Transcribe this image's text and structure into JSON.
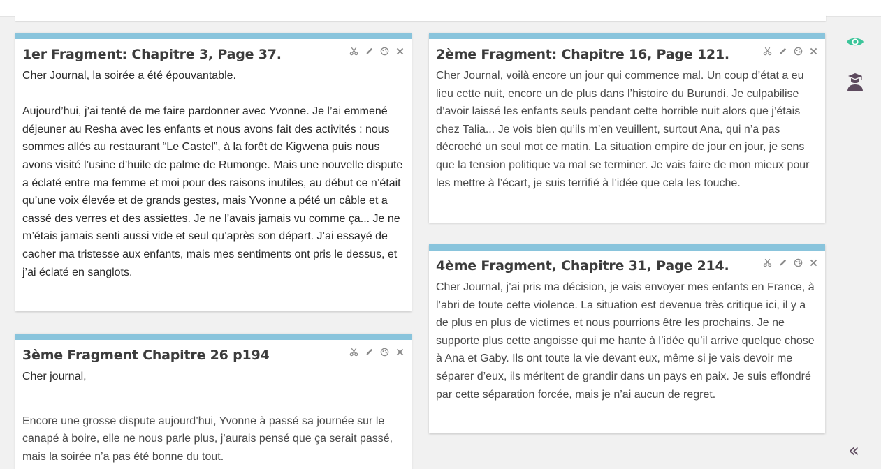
{
  "cards": [
    {
      "title": "1er Fragment: Chapitre 3, Page 37.",
      "paragraphs": [
        "Cher Journal, la soirée a été épouvantable.",
        "Aujourd’hui, j’ai tenté de me faire pardonner avec Yvonne. Je l’ai emmené déjeuner au Resha avec les enfants et nous avons fait des activités : nous sommes allés au restaurant “Le Castel”, à la forêt de Kigwena puis nous avons visité l’usine d’huile de palme de Rumonge. Mais une nouvelle dispute a éclaté entre ma femme et moi pour des raisons inutiles, au début ce n’était qu’une voix élevée et de grands gestes, mais Yvonne a pété un câble et a cassé des verres et des assiettes. Je ne l’avais jamais vu comme ça... Je ne m’étais jamais senti aussi vide et seul qu’après son départ. J’ai essayé de cacher ma tristesse aux enfants, mais mes sentiments ont pris le dessus, et j’ai éclaté en sanglots."
      ]
    },
    {
      "title": "2ème Fragment: Chapitre 16, Page 121.",
      "paragraphs": [
        "Cher Journal, voilà encore un jour qui commence mal. Un coup d’état a eu lieu cette nuit, encore un de plus dans l’histoire du Burundi. Je culpabilise d’avoir laissé les enfants seuls pendant cette horrible nuit alors que j’étais chez Talia... Je vois bien qu’ils m’en veuillent, surtout Ana, qui n’a pas décroché un seul mot ce matin. La situation empire de jour en jour, je sens que la tension politique va mal se terminer. Je vais faire de mon mieux pour les mettre à l’écart, je suis terrifié à l’idée que cela les touche."
      ]
    },
    {
      "title": "3ème Fragment Chapitre 26 p194",
      "paragraphs": [
        "Cher journal,",
        "Encore une grosse dispute aujourd’hui, Yvonne à passé sa journée sur le canapé à boire, elle ne nous parle plus, j’aurais pensé que ça serait passé, mais la soirée n’a pas été bonne du tout."
      ]
    },
    {
      "title": "4ème Fragment, Chapitre 31, Page 214.",
      "paragraphs": [
        "Cher Journal, j’ai pris ma décision, je vais envoyer mes enfants en France, à l’abri de toute cette violence. La situation est devenue très critique ici, il y a de plus en plus de victimes et nous pourrions être les prochains. Je ne supporte plus cette angoisse qui me hante à l’idée qu’il arrive quelque chose à Ana et Gaby. Ils ont toute la vie devant eux, même si je vais devoir me séparer d’eux, ils méritent de grandir dans un pays en paix. Je suis effondré par cette séparation forcée, mais je n’ai aucun de regret."
      ]
    }
  ],
  "tools": [
    "scissors-icon",
    "pencil-icon",
    "palette-icon",
    "close-icon"
  ],
  "sidebar": {
    "view_icon": "eye-icon",
    "user_icon": "graduate-icon",
    "collapse_label": "«"
  },
  "colors": {
    "card_top": "#89c4dc",
    "eye": "#3cc59a",
    "graduate": "#5d4a5e"
  }
}
